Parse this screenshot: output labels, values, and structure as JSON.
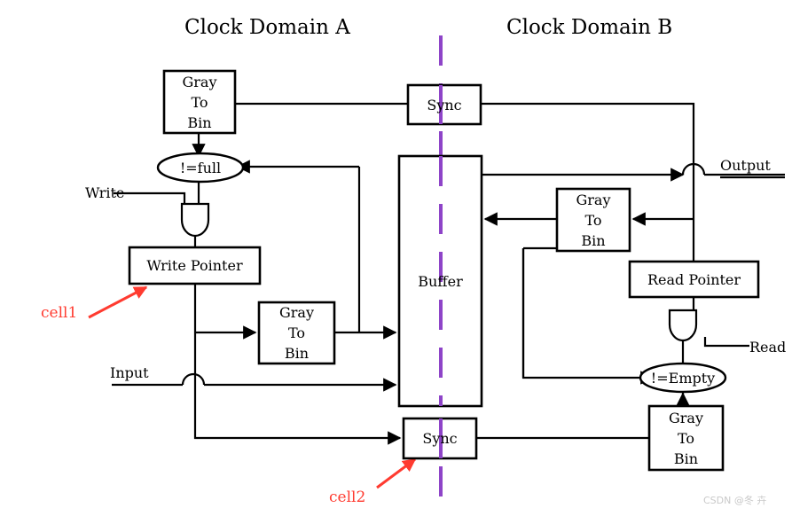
{
  "diagram": {
    "title_left": "Clock Domain A",
    "title_right": "Clock Domain B",
    "divider_color": "#8e44c8",
    "annotation_color": "#ff3b30",
    "line_color": "#000000",
    "background": "#ffffff"
  },
  "blocks": {
    "gray_to_bin_top_left": {
      "line1": "Gray",
      "line2": "To",
      "line3": "Bin"
    },
    "gray_to_bin_mid_left": {
      "line1": "Gray",
      "line2": "To",
      "line3": "Bin"
    },
    "gray_to_bin_right": {
      "line1": "Gray",
      "line2": "To",
      "line3": "Bin"
    },
    "gray_to_bin_bottom_right": {
      "line1": "Gray",
      "line2": "To",
      "line3": "Bin"
    },
    "sync_top": {
      "label": "Sync"
    },
    "sync_bottom": {
      "label": "Sync"
    },
    "buffer": {
      "label": "Buffer"
    },
    "write_pointer": {
      "label": "Write Pointer"
    },
    "read_pointer": {
      "label": "Read Pointer"
    }
  },
  "conditions": {
    "not_full": {
      "label": "!=full"
    },
    "not_empty": {
      "label": "!=Empty"
    }
  },
  "signals": {
    "write": {
      "label": "Write"
    },
    "read": {
      "label": "Read"
    },
    "input": {
      "label": "Input"
    },
    "output": {
      "label": "Output"
    }
  },
  "annotations": {
    "cell1": {
      "label": "cell1"
    },
    "cell2": {
      "label": "cell2"
    }
  },
  "watermark": {
    "text": "CSDN @冬 卉"
  }
}
